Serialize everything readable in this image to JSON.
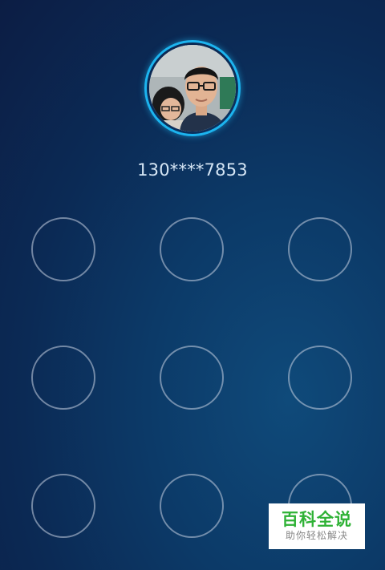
{
  "profile": {
    "avatar_icon": "user-photo",
    "ring_color": "#1cb4ef",
    "phone_masked": "130****7853"
  },
  "pattern_lock": {
    "nodes": [
      "node-1",
      "node-2",
      "node-3",
      "node-4",
      "node-5",
      "node-6",
      "node-7",
      "node-8",
      "node-9"
    ]
  },
  "watermark": {
    "title": "百科全说",
    "subtitle": "助你轻松解决",
    "title_color": "#2fb236"
  }
}
